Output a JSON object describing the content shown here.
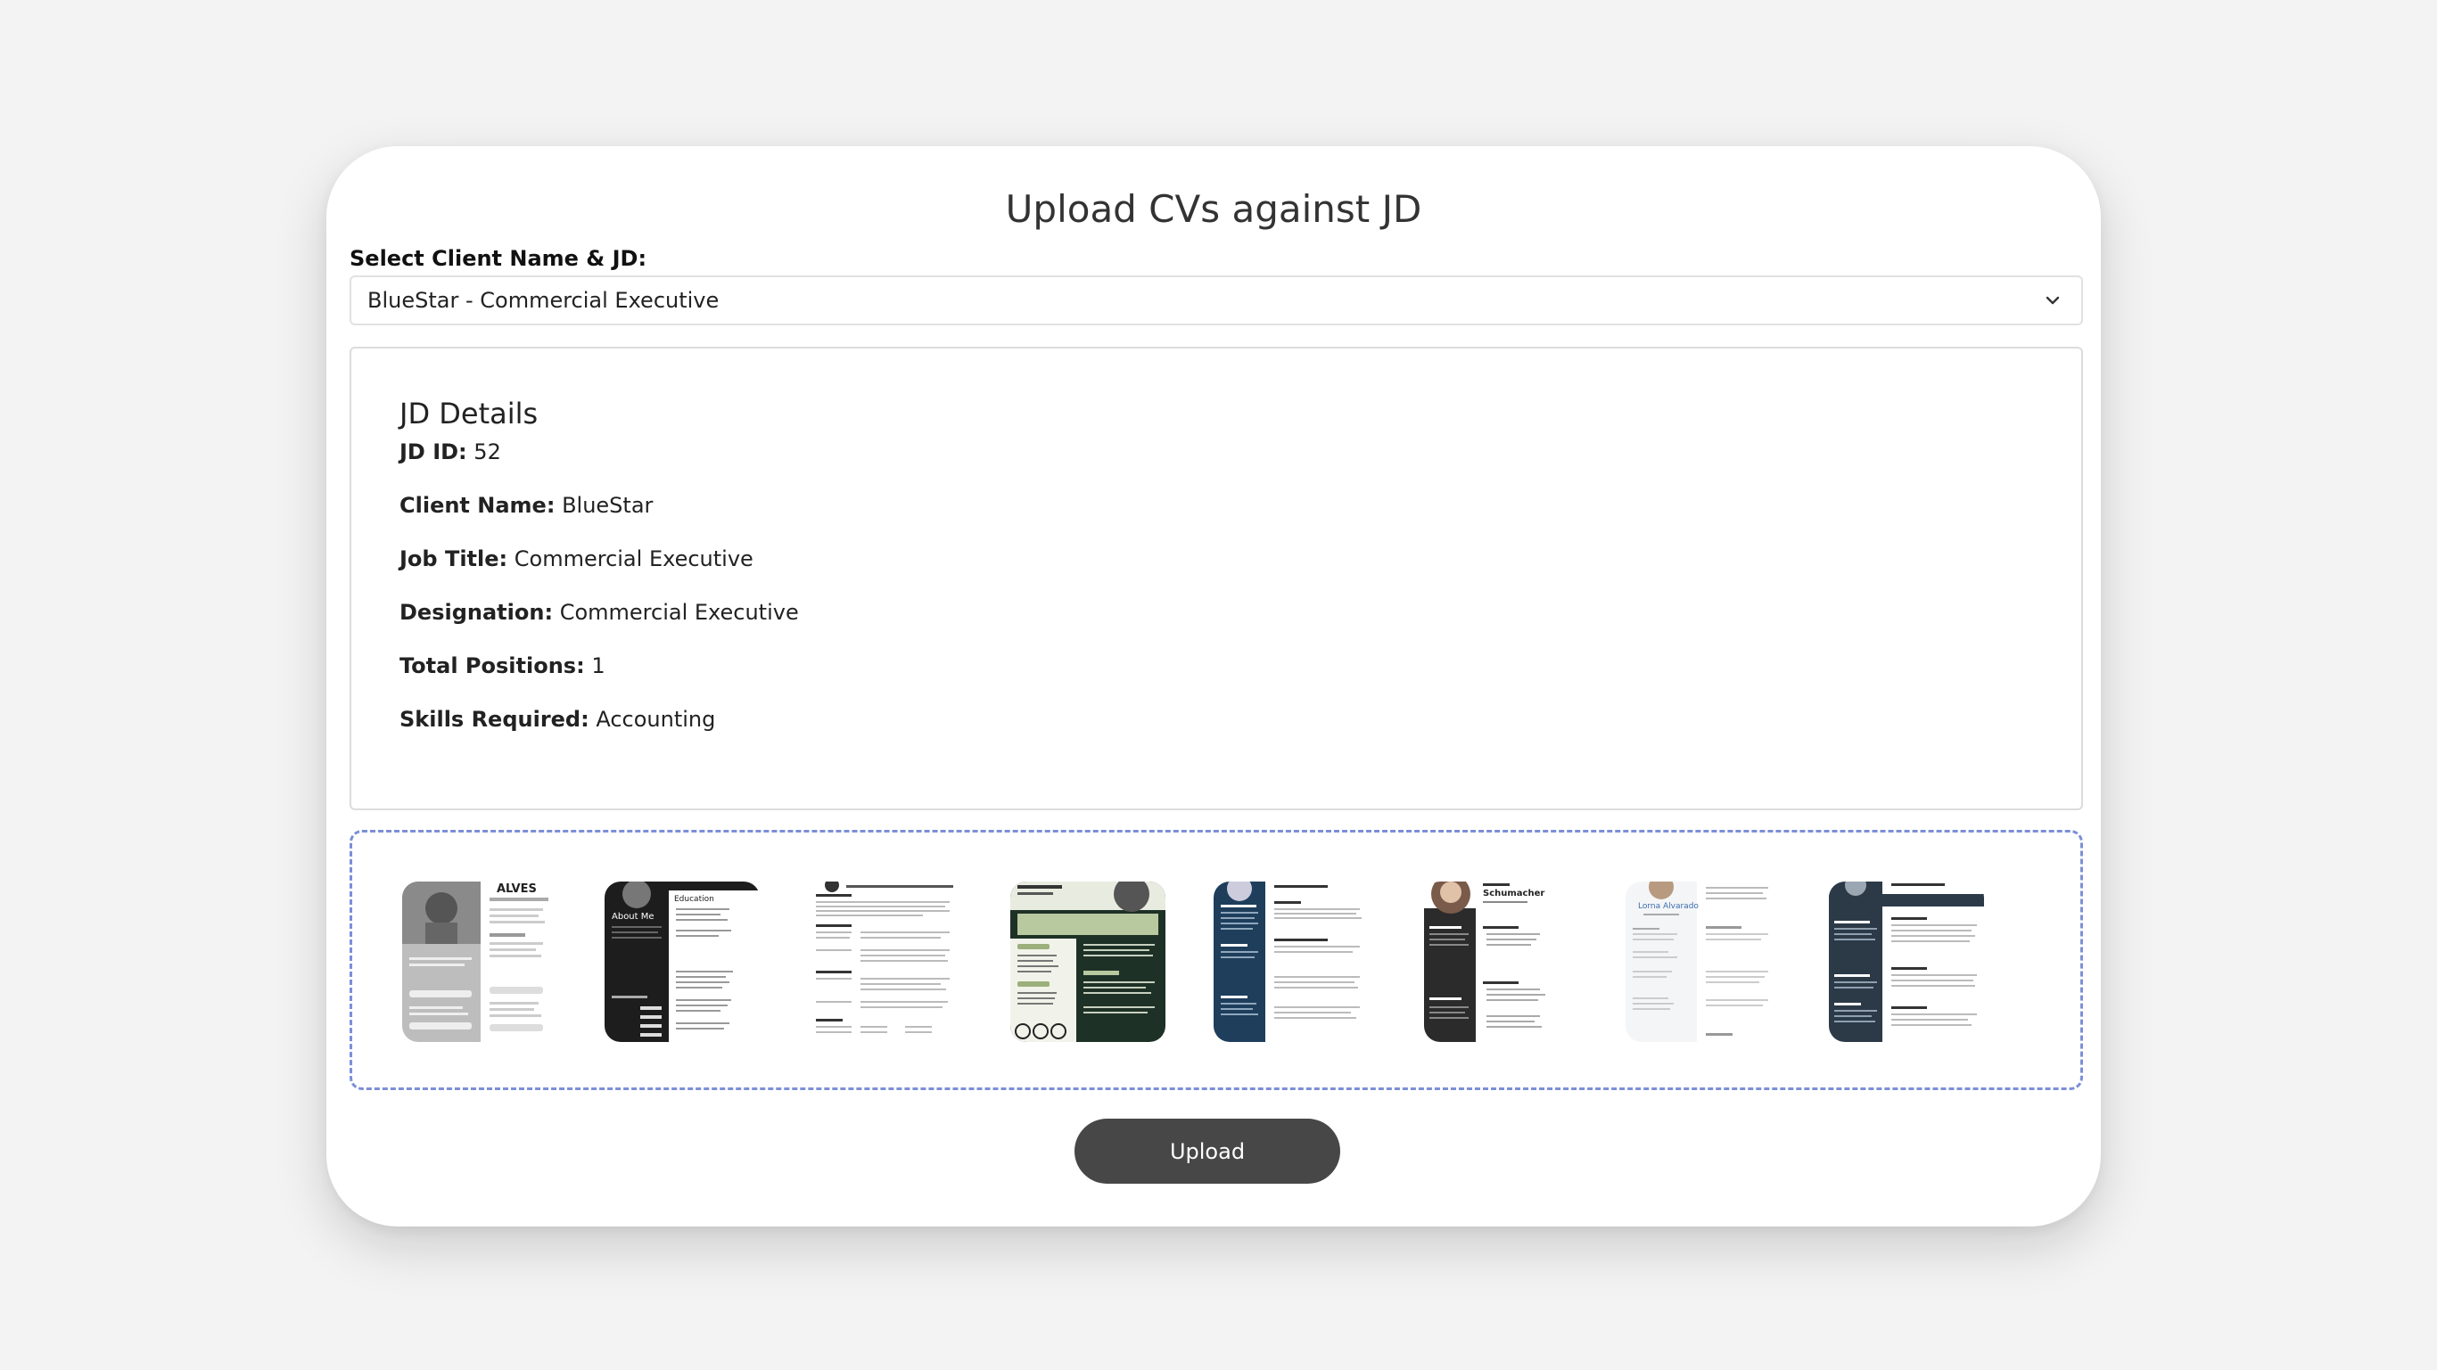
{
  "page": {
    "title": "Upload CVs against JD"
  },
  "client_select": {
    "label": "Select Client Name & JD:",
    "selected": "BlueStar - Commercial Executive",
    "icon": "chevron-down-icon"
  },
  "jd_details": {
    "heading": "JD Details",
    "fields": [
      {
        "label": "JD ID:",
        "value": "52"
      },
      {
        "label": "Client Name:",
        "value": "BlueStar"
      },
      {
        "label": "Job Title:",
        "value": "Commercial Executive"
      },
      {
        "label": "Designation:",
        "value": "Commercial Executive"
      },
      {
        "label": "Total Positions:",
        "value": "1"
      },
      {
        "label": "Skills Required:",
        "value": "Accounting"
      }
    ]
  },
  "cv_thumbnails": {
    "count": 8,
    "header_texts": [
      "ALVES",
      "About Me",
      "Education",
      "Schumacher",
      "Lorna Alvarado"
    ]
  },
  "colors": {
    "drop_zone_border": "#7b8fd8",
    "button_bg": "#474747",
    "card_bg": "#ffffff",
    "page_bg": "#f3f3f3"
  },
  "actions": {
    "upload_label": "Upload"
  }
}
